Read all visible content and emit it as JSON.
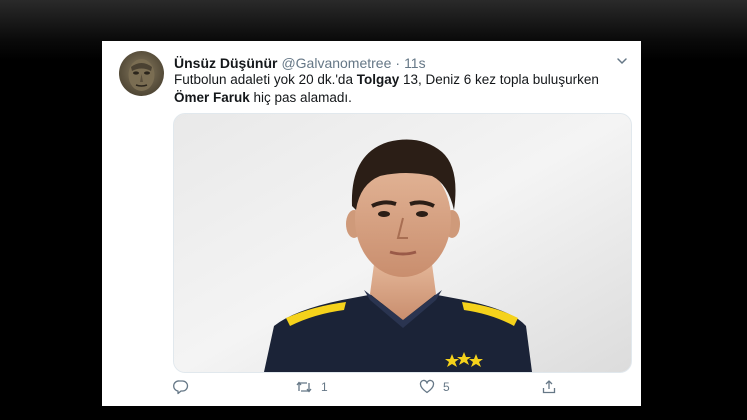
{
  "tweet": {
    "display_name": "Ünsüz Düşünür",
    "handle": "@Galvanometree",
    "separator": "·",
    "time": "11s",
    "text": {
      "line1_pre": "Futbolun adaleti yok 20 dk.'da ",
      "line1_bold": "Tolgay",
      "line1_post": " 13, Deniz 6 kez topla buluşurken",
      "line2_bold": "Ömer Faruk",
      "line2_post": " hiç pas alamadı."
    },
    "actions": {
      "reply_count": "",
      "retweet_count": "1",
      "like_count": "5"
    }
  },
  "colors": {
    "text_primary": "#14171a",
    "text_secondary": "#657786",
    "jersey_navy": "#1b2337",
    "jersey_yellow": "#f5d21b"
  },
  "icons": {
    "caret": "chevron-down-icon",
    "reply": "reply-icon",
    "retweet": "retweet-icon",
    "like": "heart-icon",
    "share": "share-icon"
  }
}
